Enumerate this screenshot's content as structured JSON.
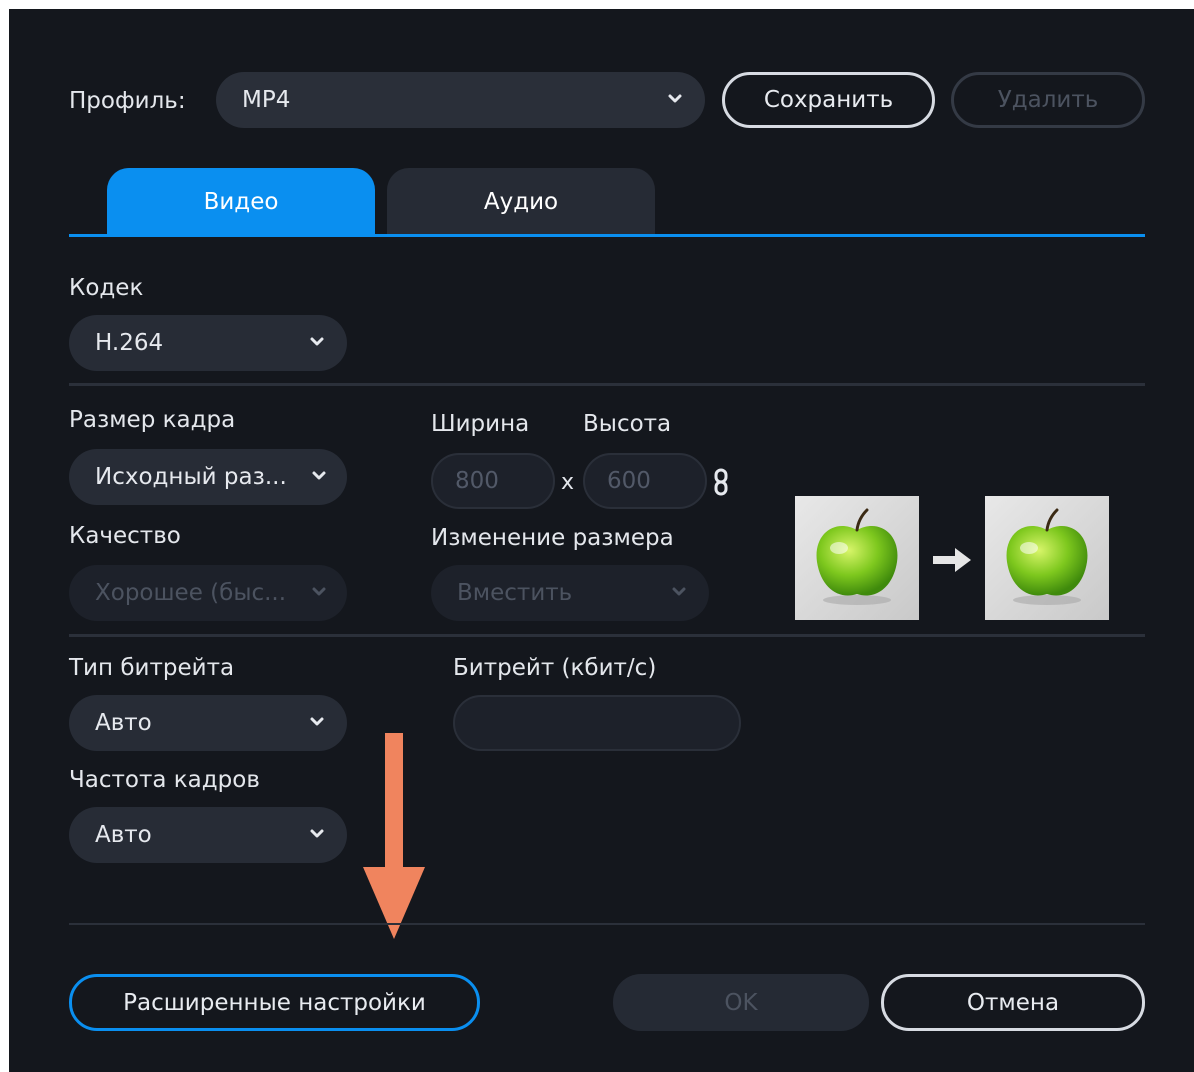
{
  "profile": {
    "label": "Профиль:",
    "value": "MP4",
    "save_label": "Сохранить",
    "delete_label": "Удалить"
  },
  "tabs": [
    {
      "label": "Видео",
      "active": true
    },
    {
      "label": "Аудио",
      "active": false
    }
  ],
  "codec": {
    "label": "Кодек",
    "value": "H.264"
  },
  "frame_size": {
    "label": "Размер кадра",
    "value": "Исходный раз..."
  },
  "dimensions": {
    "width_label": "Ширина",
    "height_label": "Высота",
    "width_value": "800",
    "height_value": "600",
    "separator": "x"
  },
  "quality": {
    "label": "Качество",
    "value": "Хорошее (быс..."
  },
  "resize": {
    "label": "Изменение размера",
    "value": "Вместить"
  },
  "bitrate_type": {
    "label": "Тип битрейта",
    "value": "Авто"
  },
  "bitrate": {
    "label": "Битрейт (кбит/с)",
    "value": ""
  },
  "frame_rate": {
    "label": "Частота кадров",
    "value": "Авто"
  },
  "footer": {
    "advanced_label": "Расширенные настройки",
    "ok_label": "OK",
    "cancel_label": "Отмена"
  },
  "colors": {
    "background": "#14171d",
    "accent": "#0a8ff0",
    "annotation_arrow": "#f0845e"
  }
}
